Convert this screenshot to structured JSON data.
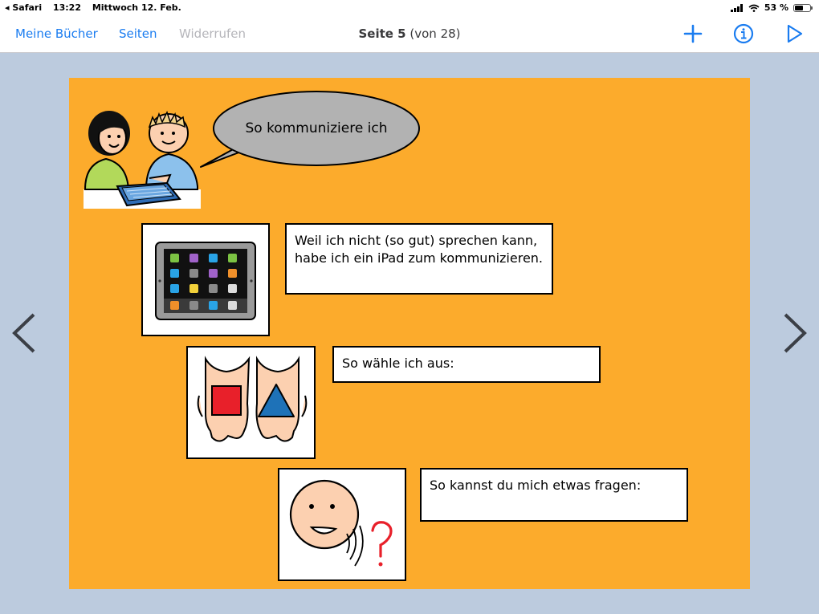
{
  "status": {
    "back_app": "Safari",
    "time": "13:22",
    "date": "Mittwoch 12. Feb.",
    "battery": "53 %",
    "battery_level": 0.53
  },
  "toolbar": {
    "books": "Meine Bücher",
    "pages": "Seiten",
    "undo": "Widerrufen",
    "title_bold": "Seite 5",
    "title_rest": "(von 28)",
    "add_icon": "plus-icon",
    "info_icon": "info-icon",
    "play_icon": "play-icon"
  },
  "page": {
    "background": "#fcab2c",
    "speech": "So kommuniziere ich",
    "rows": [
      {
        "image": "ipad-icon",
        "text": "Weil ich nicht (so gut) sprechen kann, habe ich ein iPad zum kommunizieren."
      },
      {
        "image": "hands-choice-icon",
        "text": "So wähle ich aus:"
      },
      {
        "image": "face-question-icon",
        "text": "So kannst du mich etwas fragen:"
      }
    ]
  },
  "colors": {
    "accent": "#1a7cf0",
    "disabled": "#b5b5ba",
    "frame_bg": "#bccbde"
  }
}
